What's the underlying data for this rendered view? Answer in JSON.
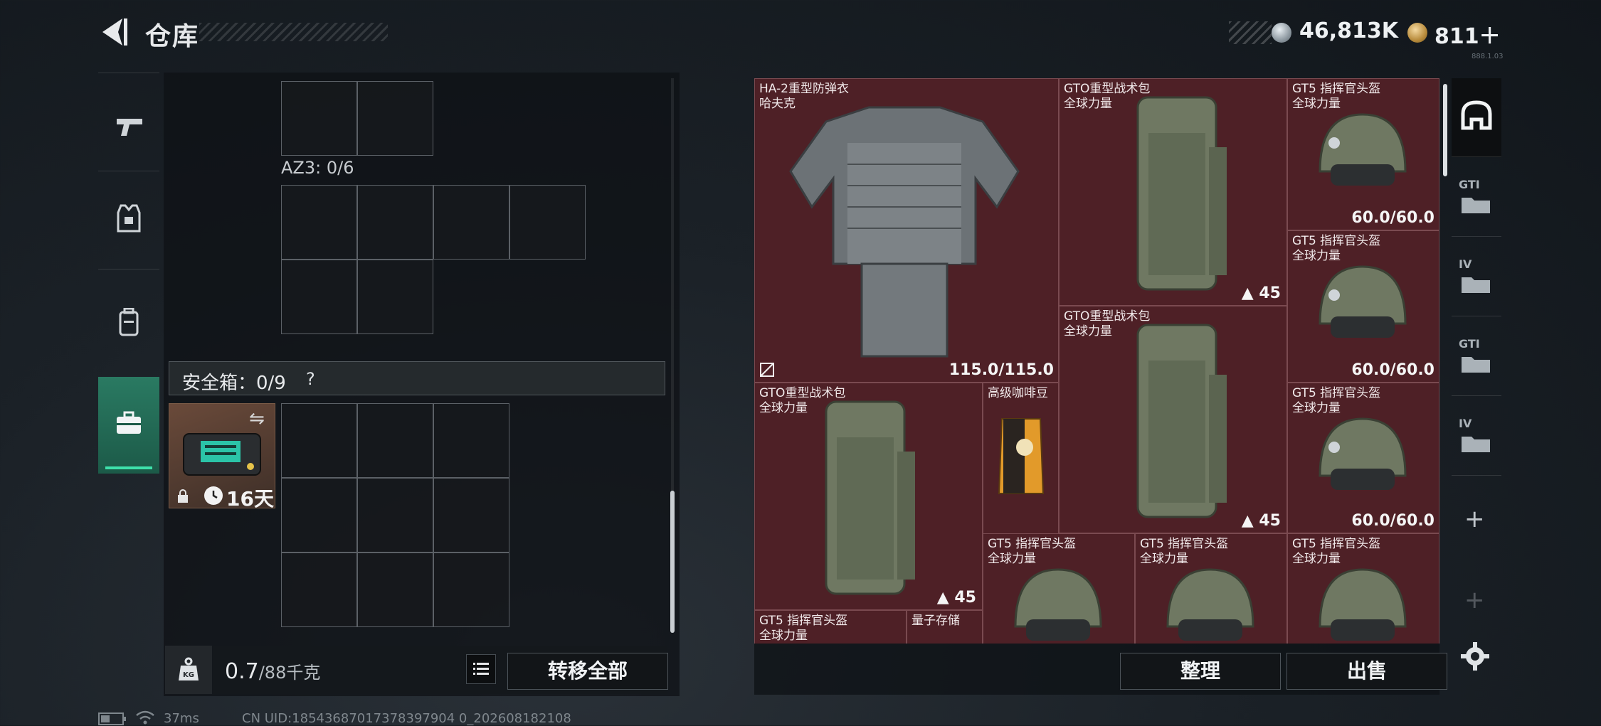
{
  "header": {
    "title": "仓库",
    "currency_silver": "46,813K",
    "currency_gold": "811＋",
    "version_text": "888.1.03"
  },
  "left_panel": {
    "az3_label": "AZ3: 0/6",
    "safe_box_label": "安全箱：0/9",
    "safe_box_help": "?",
    "safe_item_timer": "16天",
    "weight_value": "0.7",
    "weight_max": "/88千克",
    "transfer_all": "转移全部"
  },
  "stash": {
    "items": [
      {
        "name": "HA-2重型防弹衣",
        "sub": "哈夫克",
        "durability": "115.0/115.0"
      },
      {
        "name": "GTO重型战术包",
        "sub": "全球力量",
        "level": "45"
      },
      {
        "name": "GT5 指挥官头盔",
        "sub": "全球力量",
        "durability": "60.0/60.0"
      },
      {
        "name": "GT5 指挥官头盔",
        "sub": "全球力量",
        "durability": "60.0/60.0"
      },
      {
        "name": "GTO重型战术包",
        "sub": "全球力量",
        "level": "45"
      },
      {
        "name": "GTO重型战术包",
        "sub": "全球力量",
        "level": "45"
      },
      {
        "name": "高级咖啡豆",
        "sub": ""
      },
      {
        "name": "GT5 指挥官头盔",
        "sub": "全球力量",
        "durability": "60.0/60.0"
      },
      {
        "name": "GT5 指挥官头盔",
        "sub": "全球力量"
      },
      {
        "name": "GT5 指挥官头盔",
        "sub": "全球力量"
      },
      {
        "name": "GT5 指挥官头盔",
        "sub": "全球力量"
      },
      {
        "name": "GT5 指挥官头盔",
        "sub": "全球力量"
      },
      {
        "name": "量子存储",
        "sub": ""
      }
    ],
    "sort_button": "整理",
    "sell_button": "出售"
  },
  "right_tabs": [
    {
      "icon": "helmet-icon",
      "label": ""
    },
    {
      "icon": "gti-folder-icon",
      "label": "GTI"
    },
    {
      "icon": "iv-folder-icon",
      "label": "IV"
    },
    {
      "icon": "gti-folder-icon",
      "label": "GTI"
    },
    {
      "icon": "iv-folder-icon",
      "label": "IV"
    }
  ],
  "status_bar": {
    "ping": "37ms",
    "uid": "CN UID:18543687017378397904 0_202608182108"
  },
  "colors": {
    "accent": "#3ee0aa",
    "stash_bg": "#4a1f25"
  }
}
